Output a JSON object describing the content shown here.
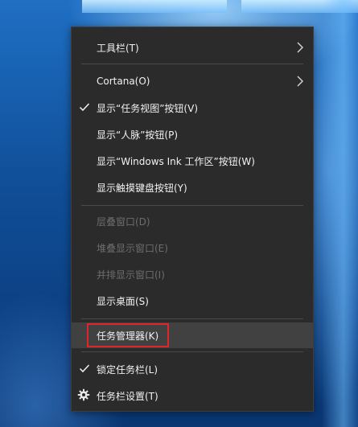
{
  "colors": {
    "menu_bg": "#2b2b2b",
    "text": "#f2f2f2",
    "disabled_text": "#6d6d6d",
    "separator": "#4a4a4a",
    "highlight_bg": "#414141",
    "annotation_box": "#e0262d"
  },
  "context_menu": {
    "items": [
      {
        "label": "工具栏(T)",
        "icon": "chevron-right-icon",
        "enabled": true,
        "checked": false
      },
      {
        "label": "Cortana(O)",
        "icon": "chevron-right-icon",
        "enabled": true,
        "checked": false
      },
      {
        "label": "显示“任务视图”按钮(V)",
        "icon": "checkmark-icon",
        "enabled": true,
        "checked": true
      },
      {
        "label": "显示“人脉”按钮(P)",
        "enabled": true,
        "checked": false
      },
      {
        "label": "显示“Windows Ink 工作区”按钮(W)",
        "enabled": true,
        "checked": false
      },
      {
        "label": "显示触摸键盘按钮(Y)",
        "enabled": true,
        "checked": false
      },
      {
        "label": "层叠窗口(D)",
        "enabled": false,
        "checked": false
      },
      {
        "label": "堆叠显示窗口(E)",
        "enabled": false,
        "checked": false
      },
      {
        "label": "并排显示窗口(I)",
        "enabled": false,
        "checked": false
      },
      {
        "label": "显示桌面(S)",
        "enabled": true,
        "checked": false
      },
      {
        "label": "任务管理器(K)",
        "enabled": true,
        "checked": false,
        "highlighted": true
      },
      {
        "label": "锁定任务栏(L)",
        "icon": "checkmark-icon",
        "enabled": true,
        "checked": true
      },
      {
        "label": "任务栏设置(T)",
        "icon": "gear-icon",
        "enabled": true,
        "checked": false
      }
    ]
  }
}
